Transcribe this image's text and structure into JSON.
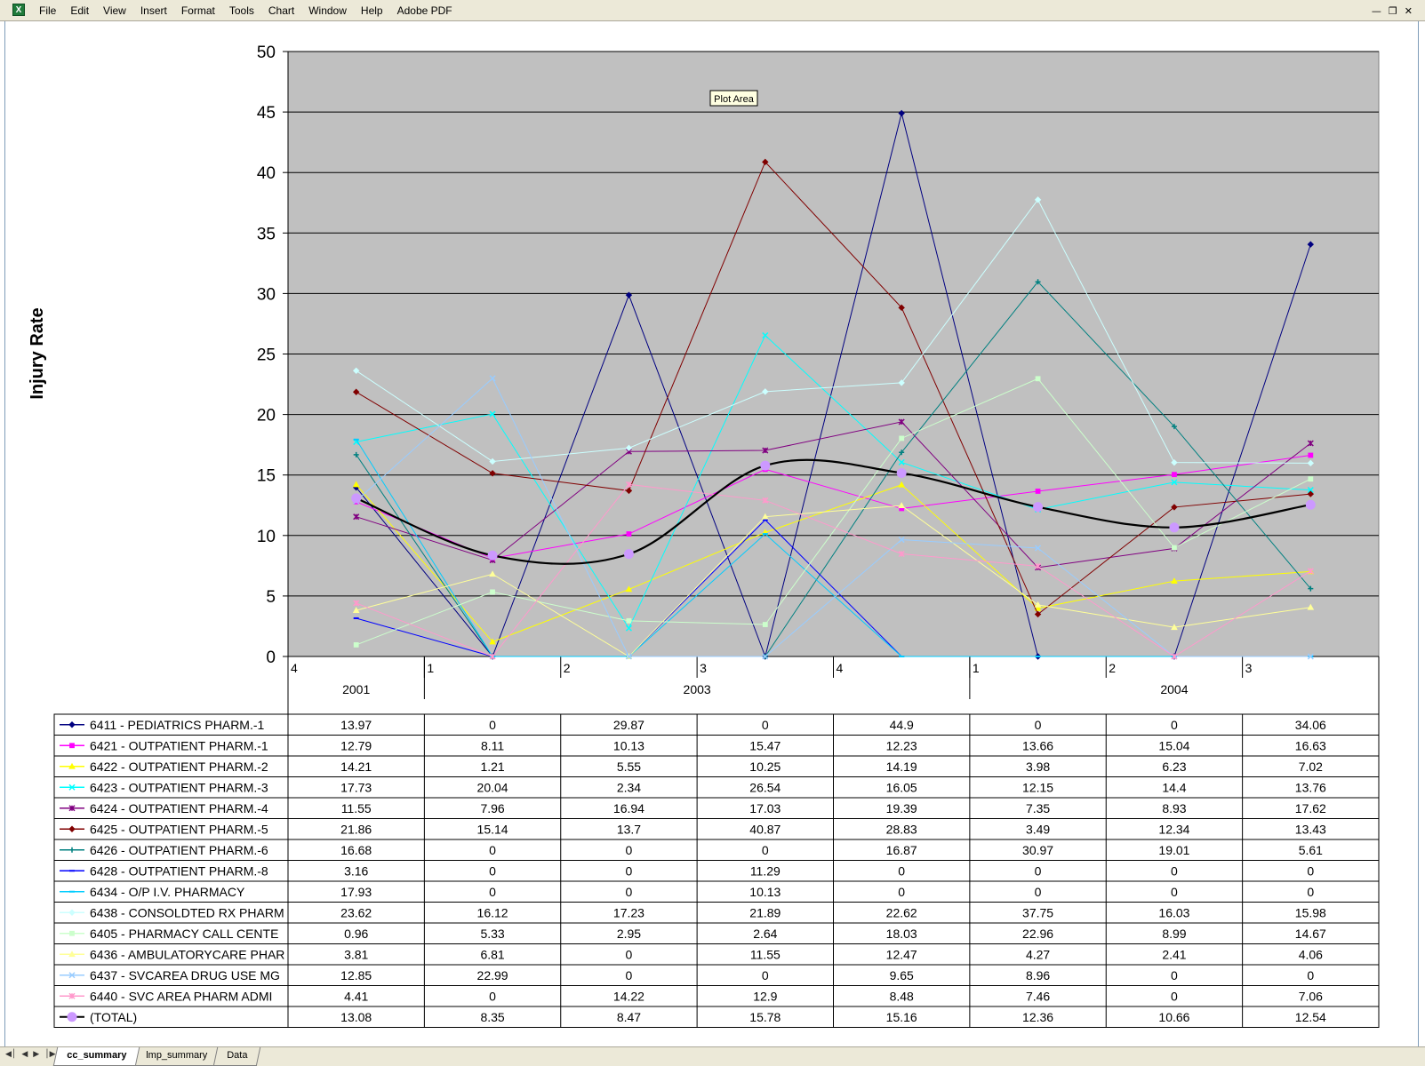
{
  "menubar": {
    "app_icon": "excel-icon",
    "items": [
      "File",
      "Edit",
      "View",
      "Insert",
      "Format",
      "Tools",
      "Chart",
      "Window",
      "Help",
      "Adobe PDF"
    ],
    "window_controls": [
      "minimize-icon",
      "restore-icon",
      "close-icon"
    ]
  },
  "sheet_tabs": {
    "nav_icons": [
      "first-sheet-icon",
      "prev-sheet-icon",
      "next-sheet-icon",
      "last-sheet-icon"
    ],
    "tabs": [
      {
        "label": "cc_summary",
        "active": true
      },
      {
        "label": "lmp_summary",
        "active": false
      },
      {
        "label": "Data",
        "active": false
      }
    ]
  },
  "tooltip": "Plot Area",
  "chart_data": {
    "type": "line",
    "ylabel": "Injury Rate",
    "ylim": [
      0,
      50
    ],
    "yticks": [
      0,
      5,
      10,
      15,
      20,
      25,
      30,
      35,
      40,
      45,
      50
    ],
    "grid": true,
    "plot_background": "#c0c0c0",
    "x_quarter_labels": [
      "4",
      "1",
      "2",
      "3",
      "4",
      "1",
      "2",
      "3"
    ],
    "x_year_groups": [
      {
        "label": "2001",
        "span": 1
      },
      {
        "label": "2003",
        "span": 4
      },
      {
        "label": "2004",
        "span": 3
      }
    ],
    "series": [
      {
        "name": "6411 - PEDIATRICS PHARM.-1",
        "color": "#000080",
        "marker": "diamond",
        "values": [
          13.97,
          0,
          29.87,
          0,
          44.9,
          0,
          0,
          34.06
        ]
      },
      {
        "name": "6421 - OUTPATIENT PHARM.-1",
        "color": "#ff00ff",
        "marker": "square",
        "values": [
          12.79,
          8.11,
          10.13,
          15.47,
          12.23,
          13.66,
          15.04,
          16.63
        ]
      },
      {
        "name": "6422 - OUTPATIENT PHARM.-2",
        "color": "#ffff00",
        "marker": "triangle",
        "values": [
          14.21,
          1.21,
          5.55,
          10.25,
          14.19,
          3.98,
          6.23,
          7.02
        ]
      },
      {
        "name": "6423 - OUTPATIENT PHARM.-3",
        "color": "#00ffff",
        "marker": "x",
        "values": [
          17.73,
          20.04,
          2.34,
          26.54,
          16.05,
          12.15,
          14.4,
          13.76
        ]
      },
      {
        "name": "6424 - OUTPATIENT PHARM.-4",
        "color": "#800080",
        "marker": "star",
        "values": [
          11.55,
          7.96,
          16.94,
          17.03,
          19.39,
          7.35,
          8.93,
          17.62
        ]
      },
      {
        "name": "6425 - OUTPATIENT PHARM.-5",
        "color": "#800000",
        "marker": "diamond",
        "values": [
          21.86,
          15.14,
          13.7,
          40.87,
          28.83,
          3.49,
          12.34,
          13.43
        ]
      },
      {
        "name": "6426 - OUTPATIENT PHARM.-6",
        "color": "#008080",
        "marker": "plus",
        "values": [
          16.68,
          0,
          0,
          0,
          16.87,
          30.97,
          19.01,
          5.61
        ]
      },
      {
        "name": "6428 - OUTPATIENT PHARM.-8",
        "color": "#0000ff",
        "marker": "dash",
        "values": [
          3.16,
          0,
          0,
          11.29,
          0,
          0,
          0,
          0
        ]
      },
      {
        "name": "6434 - O/P I.V. PHARMACY",
        "color": "#00ccff",
        "marker": "dash",
        "values": [
          17.93,
          0,
          0,
          10.13,
          0,
          0,
          0,
          0
        ]
      },
      {
        "name": "6438 - CONSOLDTED RX PHARM",
        "color": "#ccffff",
        "marker": "diamond",
        "values": [
          23.62,
          16.12,
          17.23,
          21.89,
          22.62,
          37.75,
          16.03,
          15.98
        ]
      },
      {
        "name": "6405 - PHARMACY CALL CENTE",
        "color": "#ccffcc",
        "marker": "square",
        "values": [
          0.96,
          5.33,
          2.95,
          2.64,
          18.03,
          22.96,
          8.99,
          14.67
        ]
      },
      {
        "name": "6436 - AMBULATORYCARE PHAR",
        "color": "#ffff99",
        "marker": "triangle",
        "values": [
          3.81,
          6.81,
          0,
          11.55,
          12.47,
          4.27,
          2.41,
          4.06
        ]
      },
      {
        "name": "6437 - SVCAREA DRUG USE MG",
        "color": "#99ccff",
        "marker": "x",
        "values": [
          12.85,
          22.99,
          0,
          0,
          9.65,
          8.96,
          0,
          0
        ]
      },
      {
        "name": "6440 - SVC AREA PHARM ADMI",
        "color": "#ff99cc",
        "marker": "star",
        "values": [
          4.41,
          0,
          14.22,
          12.9,
          8.48,
          7.46,
          0,
          7.06
        ]
      },
      {
        "name": "(TOTAL)",
        "color": "#000000",
        "marker": "circle",
        "smooth": true,
        "values": [
          13.08,
          8.35,
          8.47,
          15.78,
          15.16,
          12.36,
          10.66,
          12.54
        ]
      }
    ]
  }
}
